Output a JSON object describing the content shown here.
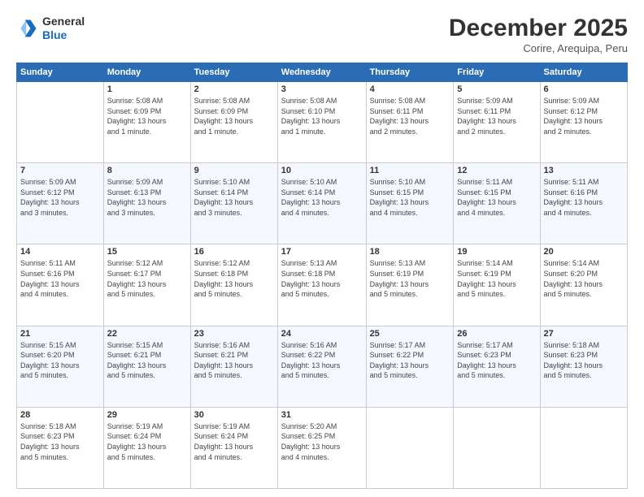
{
  "logo": {
    "general": "General",
    "blue": "Blue"
  },
  "title": "December 2025",
  "location": "Corire, Arequipa, Peru",
  "days_header": [
    "Sunday",
    "Monday",
    "Tuesday",
    "Wednesday",
    "Thursday",
    "Friday",
    "Saturday"
  ],
  "weeks": [
    [
      {
        "num": "",
        "info": ""
      },
      {
        "num": "1",
        "info": "Sunrise: 5:08 AM\nSunset: 6:09 PM\nDaylight: 13 hours\nand 1 minute."
      },
      {
        "num": "2",
        "info": "Sunrise: 5:08 AM\nSunset: 6:09 PM\nDaylight: 13 hours\nand 1 minute."
      },
      {
        "num": "3",
        "info": "Sunrise: 5:08 AM\nSunset: 6:10 PM\nDaylight: 13 hours\nand 1 minute."
      },
      {
        "num": "4",
        "info": "Sunrise: 5:08 AM\nSunset: 6:11 PM\nDaylight: 13 hours\nand 2 minutes."
      },
      {
        "num": "5",
        "info": "Sunrise: 5:09 AM\nSunset: 6:11 PM\nDaylight: 13 hours\nand 2 minutes."
      },
      {
        "num": "6",
        "info": "Sunrise: 5:09 AM\nSunset: 6:12 PM\nDaylight: 13 hours\nand 2 minutes."
      }
    ],
    [
      {
        "num": "7",
        "info": "Sunrise: 5:09 AM\nSunset: 6:12 PM\nDaylight: 13 hours\nand 3 minutes."
      },
      {
        "num": "8",
        "info": "Sunrise: 5:09 AM\nSunset: 6:13 PM\nDaylight: 13 hours\nand 3 minutes."
      },
      {
        "num": "9",
        "info": "Sunrise: 5:10 AM\nSunset: 6:14 PM\nDaylight: 13 hours\nand 3 minutes."
      },
      {
        "num": "10",
        "info": "Sunrise: 5:10 AM\nSunset: 6:14 PM\nDaylight: 13 hours\nand 4 minutes."
      },
      {
        "num": "11",
        "info": "Sunrise: 5:10 AM\nSunset: 6:15 PM\nDaylight: 13 hours\nand 4 minutes."
      },
      {
        "num": "12",
        "info": "Sunrise: 5:11 AM\nSunset: 6:15 PM\nDaylight: 13 hours\nand 4 minutes."
      },
      {
        "num": "13",
        "info": "Sunrise: 5:11 AM\nSunset: 6:16 PM\nDaylight: 13 hours\nand 4 minutes."
      }
    ],
    [
      {
        "num": "14",
        "info": "Sunrise: 5:11 AM\nSunset: 6:16 PM\nDaylight: 13 hours\nand 4 minutes."
      },
      {
        "num": "15",
        "info": "Sunrise: 5:12 AM\nSunset: 6:17 PM\nDaylight: 13 hours\nand 5 minutes."
      },
      {
        "num": "16",
        "info": "Sunrise: 5:12 AM\nSunset: 6:18 PM\nDaylight: 13 hours\nand 5 minutes."
      },
      {
        "num": "17",
        "info": "Sunrise: 5:13 AM\nSunset: 6:18 PM\nDaylight: 13 hours\nand 5 minutes."
      },
      {
        "num": "18",
        "info": "Sunrise: 5:13 AM\nSunset: 6:19 PM\nDaylight: 13 hours\nand 5 minutes."
      },
      {
        "num": "19",
        "info": "Sunrise: 5:14 AM\nSunset: 6:19 PM\nDaylight: 13 hours\nand 5 minutes."
      },
      {
        "num": "20",
        "info": "Sunrise: 5:14 AM\nSunset: 6:20 PM\nDaylight: 13 hours\nand 5 minutes."
      }
    ],
    [
      {
        "num": "21",
        "info": "Sunrise: 5:15 AM\nSunset: 6:20 PM\nDaylight: 13 hours\nand 5 minutes."
      },
      {
        "num": "22",
        "info": "Sunrise: 5:15 AM\nSunset: 6:21 PM\nDaylight: 13 hours\nand 5 minutes."
      },
      {
        "num": "23",
        "info": "Sunrise: 5:16 AM\nSunset: 6:21 PM\nDaylight: 13 hours\nand 5 minutes."
      },
      {
        "num": "24",
        "info": "Sunrise: 5:16 AM\nSunset: 6:22 PM\nDaylight: 13 hours\nand 5 minutes."
      },
      {
        "num": "25",
        "info": "Sunrise: 5:17 AM\nSunset: 6:22 PM\nDaylight: 13 hours\nand 5 minutes."
      },
      {
        "num": "26",
        "info": "Sunrise: 5:17 AM\nSunset: 6:23 PM\nDaylight: 13 hours\nand 5 minutes."
      },
      {
        "num": "27",
        "info": "Sunrise: 5:18 AM\nSunset: 6:23 PM\nDaylight: 13 hours\nand 5 minutes."
      }
    ],
    [
      {
        "num": "28",
        "info": "Sunrise: 5:18 AM\nSunset: 6:23 PM\nDaylight: 13 hours\nand 5 minutes."
      },
      {
        "num": "29",
        "info": "Sunrise: 5:19 AM\nSunset: 6:24 PM\nDaylight: 13 hours\nand 5 minutes."
      },
      {
        "num": "30",
        "info": "Sunrise: 5:19 AM\nSunset: 6:24 PM\nDaylight: 13 hours\nand 4 minutes."
      },
      {
        "num": "31",
        "info": "Sunrise: 5:20 AM\nSunset: 6:25 PM\nDaylight: 13 hours\nand 4 minutes."
      },
      {
        "num": "",
        "info": ""
      },
      {
        "num": "",
        "info": ""
      },
      {
        "num": "",
        "info": ""
      }
    ]
  ]
}
